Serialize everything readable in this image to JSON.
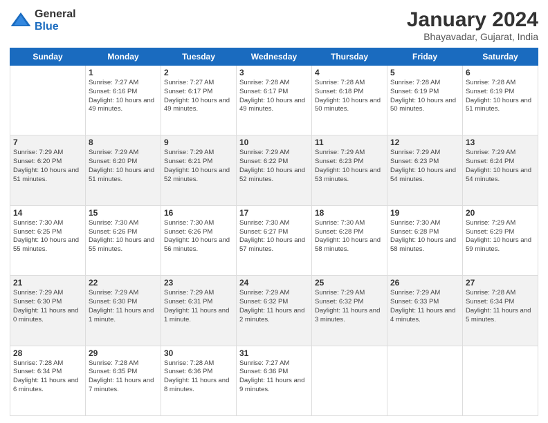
{
  "logo": {
    "general": "General",
    "blue": "Blue"
  },
  "header": {
    "title": "January 2024",
    "location": "Bhayavadar, Gujarat, India"
  },
  "weekdays": [
    "Sunday",
    "Monday",
    "Tuesday",
    "Wednesday",
    "Thursday",
    "Friday",
    "Saturday"
  ],
  "weeks": [
    [
      {
        "day": "",
        "sunrise": "",
        "sunset": "",
        "daylight": ""
      },
      {
        "day": "1",
        "sunrise": "Sunrise: 7:27 AM",
        "sunset": "Sunset: 6:16 PM",
        "daylight": "Daylight: 10 hours and 49 minutes."
      },
      {
        "day": "2",
        "sunrise": "Sunrise: 7:27 AM",
        "sunset": "Sunset: 6:17 PM",
        "daylight": "Daylight: 10 hours and 49 minutes."
      },
      {
        "day": "3",
        "sunrise": "Sunrise: 7:28 AM",
        "sunset": "Sunset: 6:17 PM",
        "daylight": "Daylight: 10 hours and 49 minutes."
      },
      {
        "day": "4",
        "sunrise": "Sunrise: 7:28 AM",
        "sunset": "Sunset: 6:18 PM",
        "daylight": "Daylight: 10 hours and 50 minutes."
      },
      {
        "day": "5",
        "sunrise": "Sunrise: 7:28 AM",
        "sunset": "Sunset: 6:19 PM",
        "daylight": "Daylight: 10 hours and 50 minutes."
      },
      {
        "day": "6",
        "sunrise": "Sunrise: 7:28 AM",
        "sunset": "Sunset: 6:19 PM",
        "daylight": "Daylight: 10 hours and 51 minutes."
      }
    ],
    [
      {
        "day": "7",
        "sunrise": "Sunrise: 7:29 AM",
        "sunset": "Sunset: 6:20 PM",
        "daylight": "Daylight: 10 hours and 51 minutes."
      },
      {
        "day": "8",
        "sunrise": "Sunrise: 7:29 AM",
        "sunset": "Sunset: 6:20 PM",
        "daylight": "Daylight: 10 hours and 51 minutes."
      },
      {
        "day": "9",
        "sunrise": "Sunrise: 7:29 AM",
        "sunset": "Sunset: 6:21 PM",
        "daylight": "Daylight: 10 hours and 52 minutes."
      },
      {
        "day": "10",
        "sunrise": "Sunrise: 7:29 AM",
        "sunset": "Sunset: 6:22 PM",
        "daylight": "Daylight: 10 hours and 52 minutes."
      },
      {
        "day": "11",
        "sunrise": "Sunrise: 7:29 AM",
        "sunset": "Sunset: 6:23 PM",
        "daylight": "Daylight: 10 hours and 53 minutes."
      },
      {
        "day": "12",
        "sunrise": "Sunrise: 7:29 AM",
        "sunset": "Sunset: 6:23 PM",
        "daylight": "Daylight: 10 hours and 54 minutes."
      },
      {
        "day": "13",
        "sunrise": "Sunrise: 7:29 AM",
        "sunset": "Sunset: 6:24 PM",
        "daylight": "Daylight: 10 hours and 54 minutes."
      }
    ],
    [
      {
        "day": "14",
        "sunrise": "Sunrise: 7:30 AM",
        "sunset": "Sunset: 6:25 PM",
        "daylight": "Daylight: 10 hours and 55 minutes."
      },
      {
        "day": "15",
        "sunrise": "Sunrise: 7:30 AM",
        "sunset": "Sunset: 6:26 PM",
        "daylight": "Daylight: 10 hours and 55 minutes."
      },
      {
        "day": "16",
        "sunrise": "Sunrise: 7:30 AM",
        "sunset": "Sunset: 6:26 PM",
        "daylight": "Daylight: 10 hours and 56 minutes."
      },
      {
        "day": "17",
        "sunrise": "Sunrise: 7:30 AM",
        "sunset": "Sunset: 6:27 PM",
        "daylight": "Daylight: 10 hours and 57 minutes."
      },
      {
        "day": "18",
        "sunrise": "Sunrise: 7:30 AM",
        "sunset": "Sunset: 6:28 PM",
        "daylight": "Daylight: 10 hours and 58 minutes."
      },
      {
        "day": "19",
        "sunrise": "Sunrise: 7:30 AM",
        "sunset": "Sunset: 6:28 PM",
        "daylight": "Daylight: 10 hours and 58 minutes."
      },
      {
        "day": "20",
        "sunrise": "Sunrise: 7:29 AM",
        "sunset": "Sunset: 6:29 PM",
        "daylight": "Daylight: 10 hours and 59 minutes."
      }
    ],
    [
      {
        "day": "21",
        "sunrise": "Sunrise: 7:29 AM",
        "sunset": "Sunset: 6:30 PM",
        "daylight": "Daylight: 11 hours and 0 minutes."
      },
      {
        "day": "22",
        "sunrise": "Sunrise: 7:29 AM",
        "sunset": "Sunset: 6:30 PM",
        "daylight": "Daylight: 11 hours and 1 minute."
      },
      {
        "day": "23",
        "sunrise": "Sunrise: 7:29 AM",
        "sunset": "Sunset: 6:31 PM",
        "daylight": "Daylight: 11 hours and 1 minute."
      },
      {
        "day": "24",
        "sunrise": "Sunrise: 7:29 AM",
        "sunset": "Sunset: 6:32 PM",
        "daylight": "Daylight: 11 hours and 2 minutes."
      },
      {
        "day": "25",
        "sunrise": "Sunrise: 7:29 AM",
        "sunset": "Sunset: 6:32 PM",
        "daylight": "Daylight: 11 hours and 3 minutes."
      },
      {
        "day": "26",
        "sunrise": "Sunrise: 7:29 AM",
        "sunset": "Sunset: 6:33 PM",
        "daylight": "Daylight: 11 hours and 4 minutes."
      },
      {
        "day": "27",
        "sunrise": "Sunrise: 7:28 AM",
        "sunset": "Sunset: 6:34 PM",
        "daylight": "Daylight: 11 hours and 5 minutes."
      }
    ],
    [
      {
        "day": "28",
        "sunrise": "Sunrise: 7:28 AM",
        "sunset": "Sunset: 6:34 PM",
        "daylight": "Daylight: 11 hours and 6 minutes."
      },
      {
        "day": "29",
        "sunrise": "Sunrise: 7:28 AM",
        "sunset": "Sunset: 6:35 PM",
        "daylight": "Daylight: 11 hours and 7 minutes."
      },
      {
        "day": "30",
        "sunrise": "Sunrise: 7:28 AM",
        "sunset": "Sunset: 6:36 PM",
        "daylight": "Daylight: 11 hours and 8 minutes."
      },
      {
        "day": "31",
        "sunrise": "Sunrise: 7:27 AM",
        "sunset": "Sunset: 6:36 PM",
        "daylight": "Daylight: 11 hours and 9 minutes."
      },
      {
        "day": "",
        "sunrise": "",
        "sunset": "",
        "daylight": ""
      },
      {
        "day": "",
        "sunrise": "",
        "sunset": "",
        "daylight": ""
      },
      {
        "day": "",
        "sunrise": "",
        "sunset": "",
        "daylight": ""
      }
    ]
  ]
}
